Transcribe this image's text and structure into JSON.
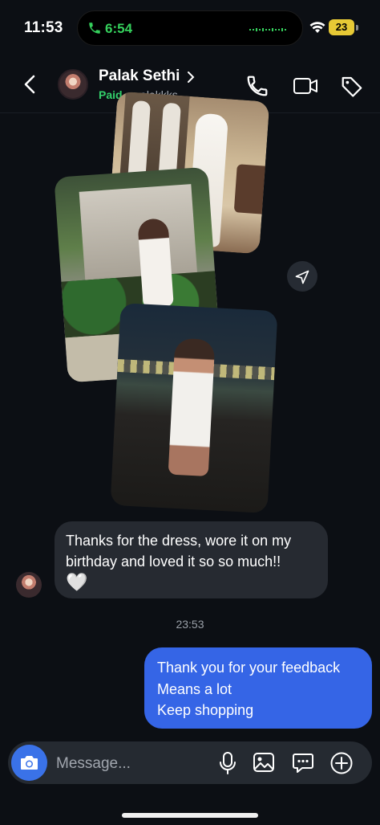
{
  "status_bar": {
    "time": "11:53",
    "call_time": "6:54",
    "battery": "23"
  },
  "header": {
    "name": "Palak Sethi",
    "badge": "Paid",
    "separator": "·",
    "handle": "palakkks"
  },
  "messages": {
    "incoming_text": "Thanks for the dress, wore it on my birthday and loved it so so much!!",
    "incoming_emoji": "🤍",
    "timestamp": "23:53",
    "outgoing_lines": [
      "Thank you for your feedback",
      "Means a lot",
      "Keep shopping"
    ]
  },
  "composer": {
    "placeholder": "Message..."
  },
  "colors": {
    "accent": "#3565e6",
    "paid": "#33d06a",
    "call": "#35d05c",
    "battery": "#e7c935"
  }
}
